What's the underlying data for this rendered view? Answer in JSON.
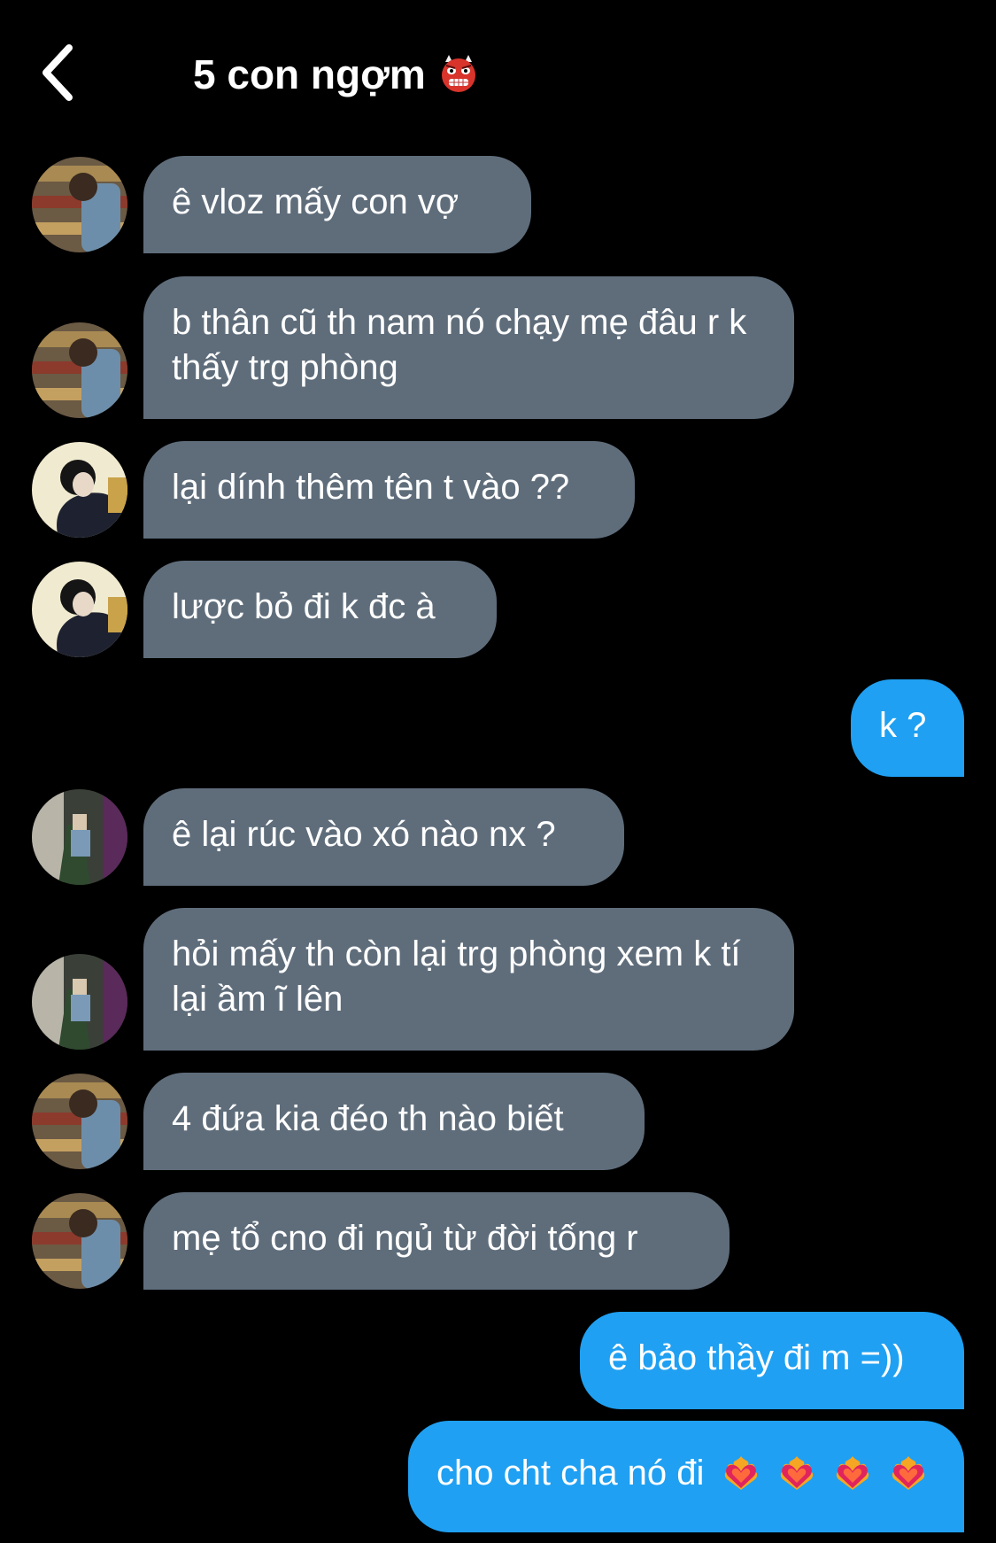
{
  "header": {
    "title": "5 con ngợm",
    "title_emoji": "ogre-emoji"
  },
  "messages": [
    {
      "dir": "in",
      "avatar": "avatar-a",
      "text": "ê vloz mấy con vợ"
    },
    {
      "dir": "in",
      "avatar": "avatar-a",
      "text": "b thân cũ th nam nó chạy mẹ đâu r k thấy trg phòng"
    },
    {
      "dir": "in",
      "avatar": "avatar-b",
      "text": "lại dính thêm tên t vào ??"
    },
    {
      "dir": "in",
      "avatar": "avatar-b",
      "text": "lược bỏ đi k đc à"
    },
    {
      "dir": "out",
      "text": "k ?"
    },
    {
      "dir": "in",
      "avatar": "avatar-c",
      "text": "ê lại rúc vào xó nào nx ?"
    },
    {
      "dir": "in",
      "avatar": "avatar-c",
      "text": "hỏi mấy th còn lại trg phòng xem k tí lại ầm ĩ lên"
    },
    {
      "dir": "in",
      "avatar": "avatar-a",
      "text": "4 đứa kia đéo th nào biết"
    },
    {
      "dir": "in",
      "avatar": "avatar-a",
      "text": "mẹ tổ cno đi ngủ từ đời tống r"
    },
    {
      "dir": "out",
      "text": "ê bảo thầy đi m =))"
    },
    {
      "dir": "out",
      "text": "cho cht cha nó đi",
      "emoji": "heart-on-fire-emoji",
      "emoji_count": 4
    }
  ],
  "colors": {
    "background": "#000000",
    "incoming_bubble": "#5f6d7b",
    "outgoing_bubble": "#1fa0f2",
    "text": "#ffffff"
  }
}
